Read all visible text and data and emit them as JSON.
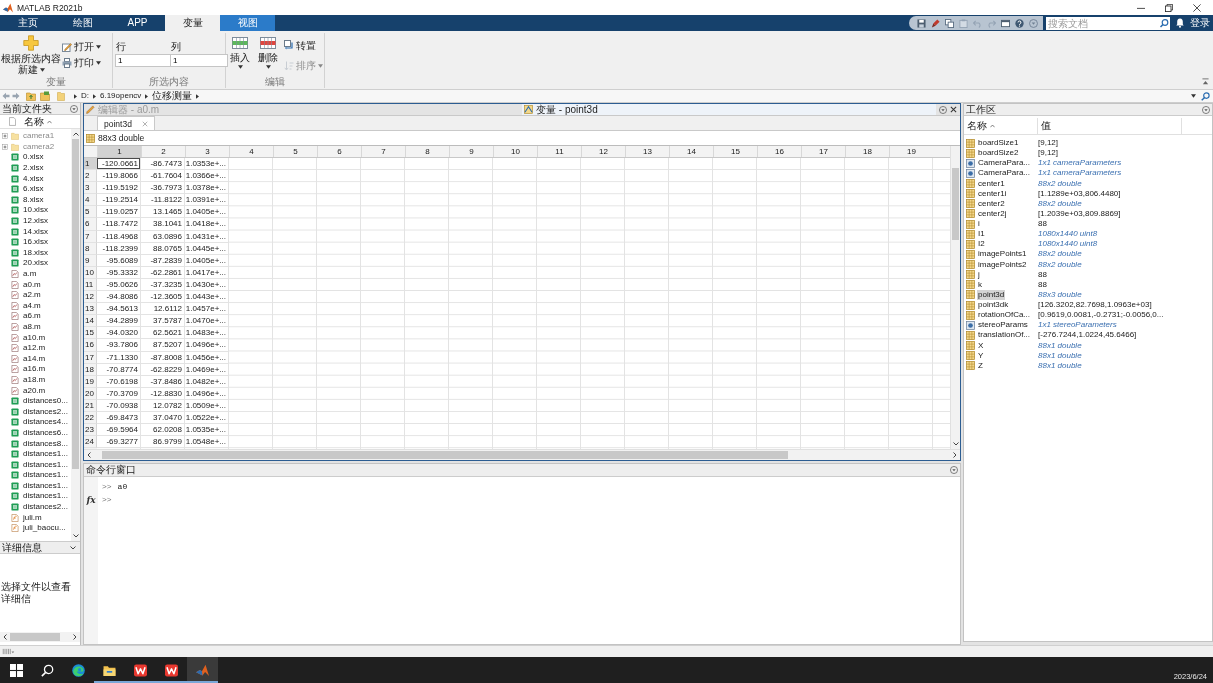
{
  "window": {
    "title": "MATLAB R2021b"
  },
  "toolstrip_tabs": [
    {
      "label": "主页",
      "selected": false,
      "contextual": false
    },
    {
      "label": "绘图",
      "selected": false,
      "contextual": false
    },
    {
      "label": "APP",
      "selected": false,
      "contextual": false
    },
    {
      "label": "变量",
      "selected": true,
      "contextual": false
    },
    {
      "label": "视图",
      "selected": false,
      "contextual": true
    }
  ],
  "search": {
    "placeholder": "搜索文档"
  },
  "sign_in": "登录",
  "ribbon": {
    "variable_group": {
      "label": "变量",
      "new_button": [
        "根据所选内容",
        "新建"
      ],
      "buttons": [
        {
          "label": "打开",
          "kind": "open"
        },
        {
          "label": "打印",
          "kind": "print"
        }
      ]
    },
    "selection_group": {
      "label": "所选内容",
      "fields": [
        {
          "label": "行",
          "value": "1"
        },
        {
          "label": "列",
          "value": "1"
        }
      ]
    },
    "edit_group": {
      "label": "编辑",
      "buttons": [
        {
          "label": "插入",
          "kind": "insert",
          "disabled": false
        },
        {
          "label": "删除",
          "kind": "delete",
          "disabled": false
        },
        {
          "label": "转置",
          "kind": "transpose",
          "disabled": false
        },
        {
          "label": "排序",
          "kind": "sort",
          "disabled": true
        }
      ]
    }
  },
  "address_bar": {
    "path": [
      "D:",
      "6.19opencv",
      "位移测量"
    ]
  },
  "current_folder": {
    "title": "当前文件夹",
    "column": "名称",
    "items": [
      {
        "name": "camera1",
        "kind": "folder"
      },
      {
        "name": "camera2",
        "kind": "folder"
      },
      {
        "name": "0.xlsx",
        "kind": "xlsx"
      },
      {
        "name": "2.xlsx",
        "kind": "xlsx"
      },
      {
        "name": "4.xlsx",
        "kind": "xlsx"
      },
      {
        "name": "6.xlsx",
        "kind": "xlsx"
      },
      {
        "name": "8.xlsx",
        "kind": "xlsx"
      },
      {
        "name": "10.xlsx",
        "kind": "xlsx"
      },
      {
        "name": "12.xlsx",
        "kind": "xlsx"
      },
      {
        "name": "14.xlsx",
        "kind": "xlsx"
      },
      {
        "name": "16.xlsx",
        "kind": "xlsx"
      },
      {
        "name": "18.xlsx",
        "kind": "xlsx"
      },
      {
        "name": "20.xlsx",
        "kind": "xlsx"
      },
      {
        "name": "a.m",
        "kind": "script"
      },
      {
        "name": "a0.m",
        "kind": "script"
      },
      {
        "name": "a2.m",
        "kind": "script"
      },
      {
        "name": "a4.m",
        "kind": "script"
      },
      {
        "name": "a6.m",
        "kind": "script"
      },
      {
        "name": "a8.m",
        "kind": "script"
      },
      {
        "name": "a10.m",
        "kind": "script"
      },
      {
        "name": "a12.m",
        "kind": "script"
      },
      {
        "name": "a14.m",
        "kind": "script"
      },
      {
        "name": "a16.m",
        "kind": "script"
      },
      {
        "name": "a18.m",
        "kind": "script"
      },
      {
        "name": "a20.m",
        "kind": "script"
      },
      {
        "name": "distances0...",
        "kind": "xlsx"
      },
      {
        "name": "distances2...",
        "kind": "xlsx"
      },
      {
        "name": "distances4...",
        "kind": "xlsx"
      },
      {
        "name": "distances6...",
        "kind": "xlsx"
      },
      {
        "name": "distances8...",
        "kind": "xlsx"
      },
      {
        "name": "distances1...",
        "kind": "xlsx"
      },
      {
        "name": "distances1...",
        "kind": "xlsx"
      },
      {
        "name": "distances1...",
        "kind": "xlsx"
      },
      {
        "name": "distances1...",
        "kind": "xlsx"
      },
      {
        "name": "distances1...",
        "kind": "xlsx"
      },
      {
        "name": "distances2...",
        "kind": "xlsx"
      },
      {
        "name": "juli.m",
        "kind": "function"
      },
      {
        "name": "juli_baocu...",
        "kind": "function"
      }
    ]
  },
  "details": {
    "title": "详细信息",
    "message": "选择文件以查看详细信"
  },
  "documents": [
    {
      "label": "编辑器 - a0.m",
      "kind": "editor",
      "selected": false
    },
    {
      "label": "变量 - point3d",
      "kind": "variable",
      "selected": true
    }
  ],
  "variable_tabs": [
    {
      "label": "point3d",
      "selected": true
    }
  ],
  "variable_size": "88x3 double",
  "table": {
    "columns": [
      {
        "label": "1",
        "selected": true
      },
      {
        "label": "2",
        "selected": false
      },
      {
        "label": "3",
        "selected": false
      },
      {
        "label": "4",
        "selected": false
      },
      {
        "label": "5",
        "selected": false
      },
      {
        "label": "6",
        "selected": false
      },
      {
        "label": "7",
        "selected": false
      },
      {
        "label": "8",
        "selected": false
      },
      {
        "label": "9",
        "selected": false
      },
      {
        "label": "10",
        "selected": false
      },
      {
        "label": "11",
        "selected": false
      },
      {
        "label": "12",
        "selected": false
      },
      {
        "label": "13",
        "selected": false
      },
      {
        "label": "14",
        "selected": false
      },
      {
        "label": "15",
        "selected": false
      },
      {
        "label": "16",
        "selected": false
      },
      {
        "label": "17",
        "selected": false
      },
      {
        "label": "18",
        "selected": false
      },
      {
        "label": "19",
        "selected": false
      }
    ],
    "rows": [
      {
        "label": "1",
        "selected": true,
        "cells": [
          "-120.0661",
          "-86.7473",
          "1.0353e+..."
        ]
      },
      {
        "label": "2",
        "selected": false,
        "cells": [
          "-119.8066",
          "-61.7604",
          "1.0366e+..."
        ]
      },
      {
        "label": "3",
        "selected": false,
        "cells": [
          "-119.5192",
          "-36.7973",
          "1.0378e+..."
        ]
      },
      {
        "label": "4",
        "selected": false,
        "cells": [
          "-119.2514",
          "-11.8122",
          "1.0391e+..."
        ]
      },
      {
        "label": "5",
        "selected": false,
        "cells": [
          "-119.0257",
          "13.1465",
          "1.0405e+..."
        ]
      },
      {
        "label": "6",
        "selected": false,
        "cells": [
          "-118.7472",
          "38.1041",
          "1.0418e+..."
        ]
      },
      {
        "label": "7",
        "selected": false,
        "cells": [
          "-118.4968",
          "63.0896",
          "1.0431e+..."
        ]
      },
      {
        "label": "8",
        "selected": false,
        "cells": [
          "-118.2399",
          "88.0765",
          "1.0445e+..."
        ]
      },
      {
        "label": "9",
        "selected": false,
        "cells": [
          "-95.6089",
          "-87.2839",
          "1.0405e+..."
        ]
      },
      {
        "label": "10",
        "selected": false,
        "cells": [
          "-95.3332",
          "-62.2861",
          "1.0417e+..."
        ]
      },
      {
        "label": "11",
        "selected": false,
        "cells": [
          "-95.0626",
          "-37.3235",
          "1.0430e+..."
        ]
      },
      {
        "label": "12",
        "selected": false,
        "cells": [
          "-94.8086",
          "-12.3605",
          "1.0443e+..."
        ]
      },
      {
        "label": "13",
        "selected": false,
        "cells": [
          "-94.5613",
          "12.6112",
          "1.0457e+..."
        ]
      },
      {
        "label": "14",
        "selected": false,
        "cells": [
          "-94.2899",
          "37.5787",
          "1.0470e+..."
        ]
      },
      {
        "label": "15",
        "selected": false,
        "cells": [
          "-94.0320",
          "62.5621",
          "1.0483e+..."
        ]
      },
      {
        "label": "16",
        "selected": false,
        "cells": [
          "-93.7806",
          "87.5207",
          "1.0496e+..."
        ]
      },
      {
        "label": "17",
        "selected": false,
        "cells": [
          "-71.1330",
          "-87.8008",
          "1.0456e+..."
        ]
      },
      {
        "label": "18",
        "selected": false,
        "cells": [
          "-70.8774",
          "-62.8229",
          "1.0469e+..."
        ]
      },
      {
        "label": "19",
        "selected": false,
        "cells": [
          "-70.6198",
          "-37.8486",
          "1.0482e+..."
        ]
      },
      {
        "label": "20",
        "selected": false,
        "cells": [
          "-70.3709",
          "-12.8830",
          "1.0496e+..."
        ]
      },
      {
        "label": "21",
        "selected": false,
        "cells": [
          "-70.0938",
          "12.0782",
          "1.0509e+..."
        ]
      },
      {
        "label": "22",
        "selected": false,
        "cells": [
          "-69.8473",
          "37.0470",
          "1.0522e+..."
        ]
      },
      {
        "label": "23",
        "selected": false,
        "cells": [
          "-69.5964",
          "62.0208",
          "1.0535e+..."
        ]
      },
      {
        "label": "24",
        "selected": false,
        "cells": [
          "-69.3277",
          "86.9799",
          "1.0548e+..."
        ]
      }
    ]
  },
  "command_window": {
    "title": "命令行窗口",
    "history": [
      {
        "prompt": ">>",
        "input": "a0"
      }
    ],
    "function_button": "fx",
    "prompt": ">>"
  },
  "workspace": {
    "title": "工作区",
    "columns": [
      "名称",
      "值"
    ],
    "rows": [
      {
        "name": "boardSize1",
        "value": "[9,12]",
        "kind": "array",
        "summary": false,
        "selected": false
      },
      {
        "name": "boardSize2",
        "value": "[9,12]",
        "kind": "array",
        "summary": false,
        "selected": false
      },
      {
        "name": "CameraPara...",
        "value": "1x1 cameraParameters",
        "kind": "object",
        "summary": true,
        "selected": false
      },
      {
        "name": "CameraPara...",
        "value": "1x1 cameraParameters",
        "kind": "object",
        "summary": true,
        "selected": false
      },
      {
        "name": "center1",
        "value": "88x2 double",
        "kind": "array",
        "summary": true,
        "selected": false
      },
      {
        "name": "center1i",
        "value": "[1.1289e+03,806.4480]",
        "kind": "array",
        "summary": false,
        "selected": false
      },
      {
        "name": "center2",
        "value": "88x2 double",
        "kind": "array",
        "summary": true,
        "selected": false
      },
      {
        "name": "center2j",
        "value": "[1.2039e+03,809.8869]",
        "kind": "array",
        "summary": false,
        "selected": false
      },
      {
        "name": "i",
        "value": "88",
        "kind": "array",
        "summary": false,
        "selected": false
      },
      {
        "name": "I1",
        "value": "1080x1440 uint8",
        "kind": "array",
        "summary": true,
        "selected": false
      },
      {
        "name": "I2",
        "value": "1080x1440 uint8",
        "kind": "array",
        "summary": true,
        "selected": false
      },
      {
        "name": "imagePoints1",
        "value": "88x2 double",
        "kind": "array",
        "summary": true,
        "selected": false
      },
      {
        "name": "imagePoints2",
        "value": "88x2 double",
        "kind": "array",
        "summary": true,
        "selected": false
      },
      {
        "name": "j",
        "value": "88",
        "kind": "array",
        "summary": false,
        "selected": false
      },
      {
        "name": "k",
        "value": "88",
        "kind": "array",
        "summary": false,
        "selected": false
      },
      {
        "name": "point3d",
        "value": "88x3 double",
        "kind": "array",
        "summary": true,
        "selected": true
      },
      {
        "name": "point3dk",
        "value": "[126.3202,82.7698,1.0963e+03]",
        "kind": "array",
        "summary": false,
        "selected": false
      },
      {
        "name": "rotationOfCa...",
        "value": "[0.9619,0.0081,-0.2731;-0.0056,0...",
        "kind": "array",
        "summary": false,
        "selected": false
      },
      {
        "name": "stereoParams",
        "value": "1x1 stereoParameters",
        "kind": "object",
        "summary": true,
        "selected": false
      },
      {
        "name": "translationOf...",
        "value": "[-276.7244,1.0224,45.6466]",
        "kind": "array",
        "summary": false,
        "selected": false
      },
      {
        "name": "X",
        "value": "88x1 double",
        "kind": "array",
        "summary": true,
        "selected": false
      },
      {
        "name": "Y",
        "value": "88x1 double",
        "kind": "array",
        "summary": true,
        "selected": false
      },
      {
        "name": "Z",
        "value": "88x1 double",
        "kind": "array",
        "summary": true,
        "selected": false
      }
    ]
  },
  "taskbar": {
    "items": [
      {
        "kind": "start",
        "running": false,
        "active": false
      },
      {
        "kind": "search",
        "running": false,
        "active": false
      },
      {
        "kind": "browser",
        "running": false,
        "active": false
      },
      {
        "kind": "explorer",
        "running": true,
        "active": false
      },
      {
        "kind": "office",
        "running": true,
        "active": false
      },
      {
        "kind": "office",
        "running": true,
        "active": false
      },
      {
        "kind": "matlab",
        "running": true,
        "active": true
      }
    ],
    "date": "2023/6/24"
  }
}
